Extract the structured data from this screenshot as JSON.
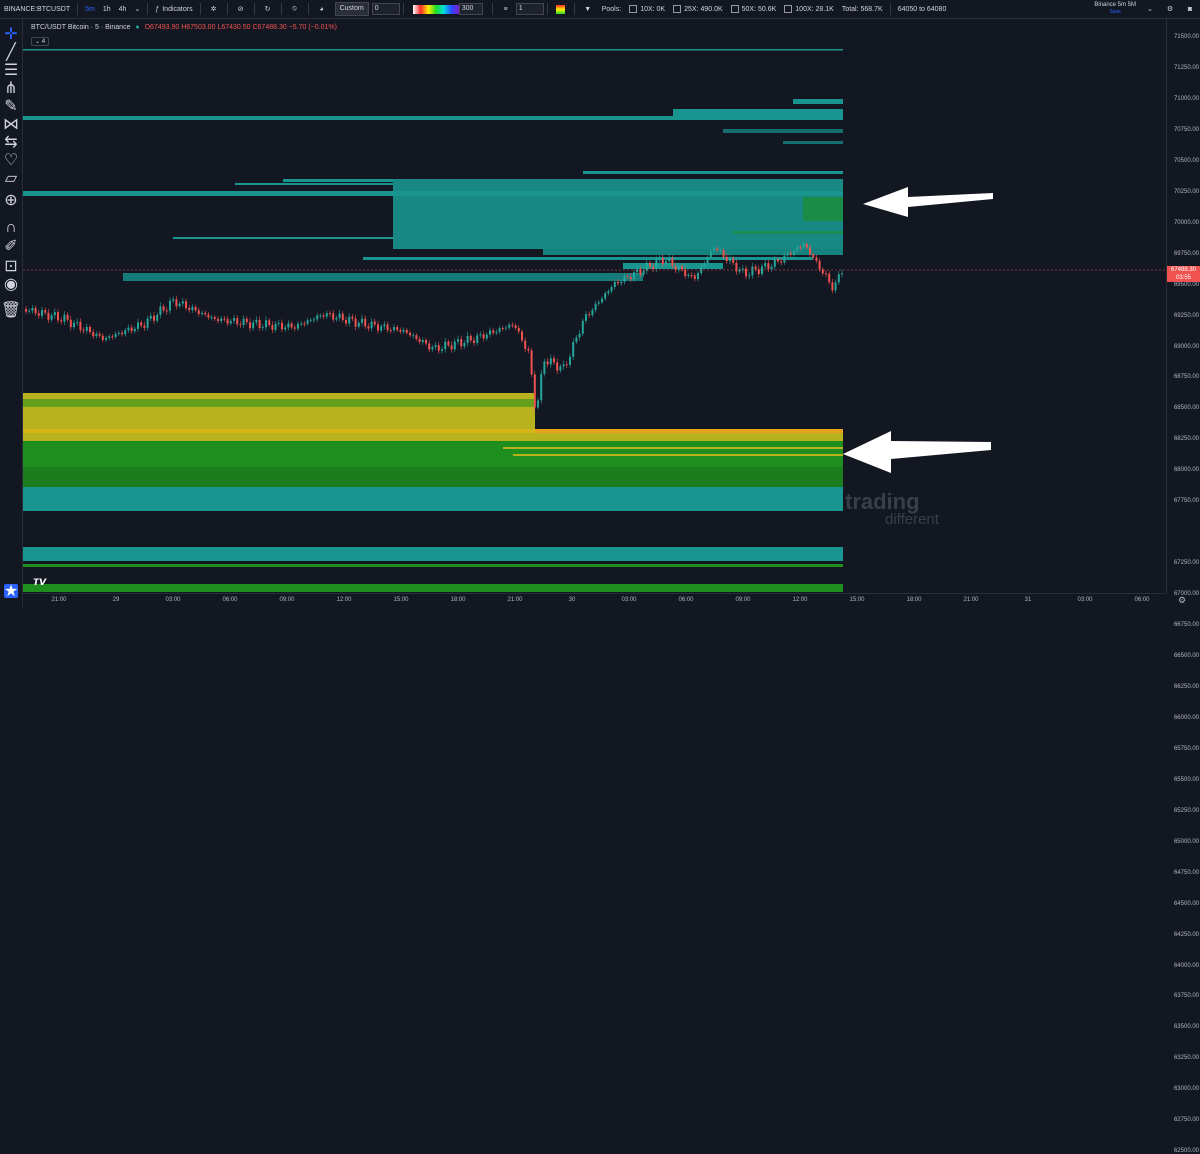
{
  "toolbar": {
    "symbol": "BINANCE:BTCUSDT",
    "intervals": [
      "5m",
      "1h",
      "4h"
    ],
    "indicators_label": "Indicators",
    "custom_select": "Custom",
    "custom_input": "0",
    "gradient_value": "300",
    "step_input": "1",
    "pools_label": "Pools:",
    "pools": [
      "10X: 0K",
      "25X: 490.0K",
      "50X: 50.6K",
      "100X: 28.1K"
    ],
    "total": "Total: 568.7K",
    "range": "64050 to 64080",
    "layout_title": "Binance 5m 5M",
    "layout_sub": "Save"
  },
  "legend": {
    "title": "BTC/USDT Bitcoin · 5 · Binance",
    "open": "O67493.90",
    "high": "H67503.00",
    "low": "L67430.50",
    "close": "C67488.30",
    "change": "−5.70 (−0.01%)",
    "hide_count": "4"
  },
  "price_axis": {
    "labels": [
      "71500.00",
      "71250.00",
      "71000.00",
      "70750.00",
      "70500.00",
      "70250.00",
      "70000.00",
      "69750.00",
      "69500.00",
      "69250.00",
      "69000.00",
      "68750.00",
      "68500.00",
      "68250.00",
      "68000.00",
      "67750.00",
      "67250.00",
      "67000.00",
      "66750.00",
      "66500.00",
      "66250.00",
      "66000.00",
      "65750.00",
      "65500.00",
      "65250.00",
      "65000.00",
      "64750.00",
      "64500.00",
      "64250.00",
      "64000.00",
      "63750.00",
      "63500.00",
      "63250.00",
      "63000.00",
      "62750.00",
      "62500.00"
    ],
    "current_price": "67488.30",
    "countdown": "03:55"
  },
  "time_axis": {
    "labels": [
      "21:00",
      "29",
      "03:00",
      "06:00",
      "09:00",
      "12:00",
      "15:00",
      "18:00",
      "21:00",
      "30",
      "03:00",
      "06:00",
      "09:00",
      "12:00",
      "15:00",
      "18:00",
      "21:00",
      "31",
      "03:00",
      "06:00"
    ]
  },
  "watermark": {
    "line1": "trading",
    "line2": "different"
  },
  "colors": {
    "bg": "#131722",
    "teal": "#18958f",
    "green": "#1e8f1e",
    "yellow": "#b8b21e",
    "up": "#26a69a",
    "down": "#ef5350",
    "arrow": "#ffffff"
  }
}
